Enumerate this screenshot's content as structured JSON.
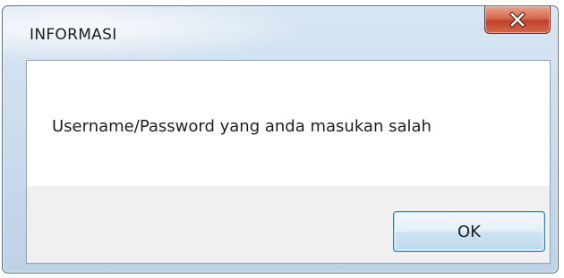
{
  "dialog": {
    "title": "INFORMASI",
    "message": "Username/Password yang anda masukan salah",
    "ok_label": "OK"
  },
  "icons": {
    "close": "close-icon"
  },
  "colors": {
    "close_button": "#c0412a",
    "ok_button_border": "#3c7fb1",
    "frame": "#cfdfee"
  }
}
